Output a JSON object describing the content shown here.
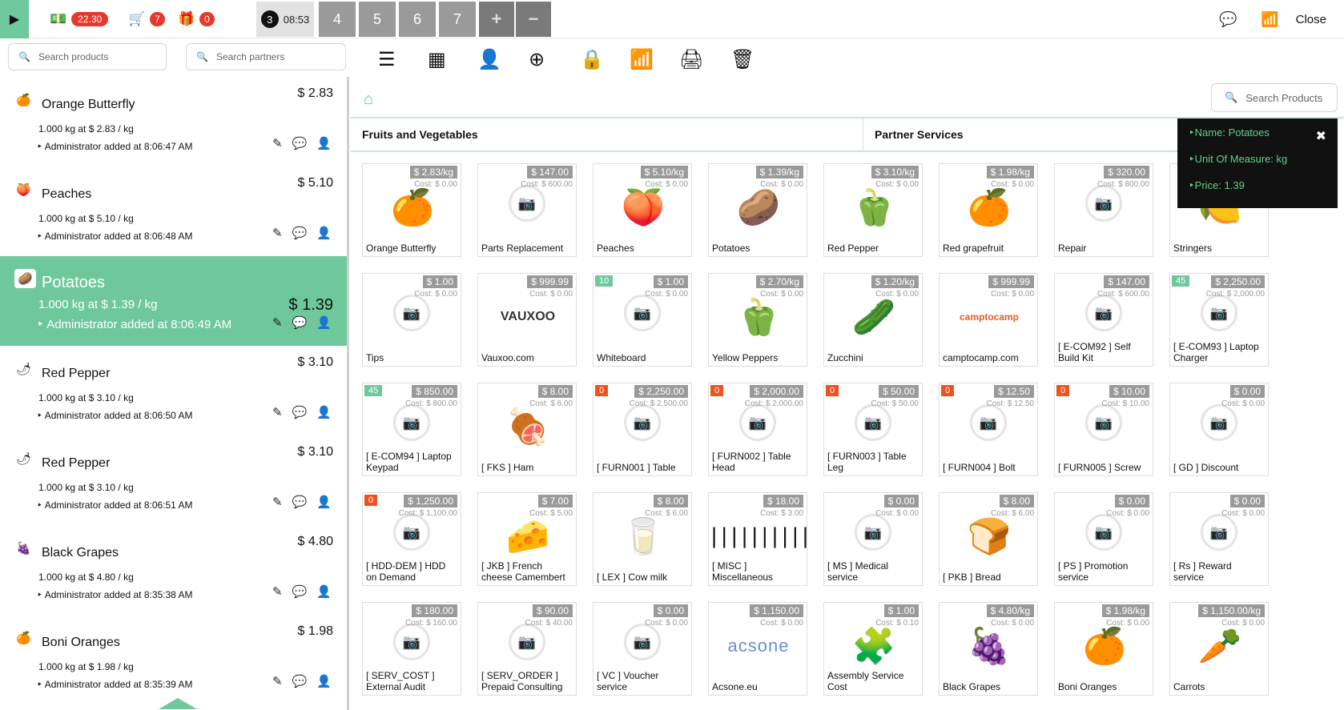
{
  "topbar": {
    "cash_badge": "22.30",
    "cart_count": "7",
    "gift_count": "0",
    "active_order_number": "3",
    "active_order_time": "08:53",
    "order_tabs": [
      "4",
      "5",
      "6",
      "7"
    ],
    "add_order": "+",
    "remove_order": "−",
    "close_label": "Close"
  },
  "left": {
    "search_products_placeholder": "Search products",
    "search_partners_placeholder": "Search partners",
    "lines": [
      {
        "name": "Orange Butterfly",
        "price": "$ 2.83",
        "qty": "1.000 kg at $ 2.83 / kg",
        "note": "Administrator added at 8:06:47 AM",
        "icon": "🍊",
        "selected": false
      },
      {
        "name": "Peaches",
        "price": "$ 5.10",
        "qty": "1.000 kg at $ 5.10 / kg",
        "note": "Administrator added at 8:06:48 AM",
        "icon": "🍑",
        "selected": false
      },
      {
        "name": "Potatoes",
        "price": "$ 1.39",
        "qty": "1.000 kg at $ 1.39 / kg",
        "note": "Administrator added at 8:06:49 AM",
        "icon": "🥔",
        "selected": true
      },
      {
        "name": "Red Pepper",
        "price": "$ 3.10",
        "qty": "1.000 kg at $ 3.10 / kg",
        "note": "Administrator added at 8:06:50 AM",
        "icon": "🌶",
        "selected": false
      },
      {
        "name": "Red Pepper",
        "price": "$ 3.10",
        "qty": "1.000 kg at $ 3.10 / kg",
        "note": "Administrator added at 8:06:51 AM",
        "icon": "🌶",
        "selected": false
      },
      {
        "name": "Black Grapes",
        "price": "$ 4.80",
        "qty": "1.000 kg at $ 4.80 / kg",
        "note": "Administrator added at 8:35:38 AM",
        "icon": "🍇",
        "selected": false
      },
      {
        "name": "Boni Oranges",
        "price": "$ 1.98",
        "qty": "1.000 kg at $ 1.98 / kg",
        "note": "Administrator added at 8:35:39 AM",
        "icon": "🍊",
        "selected": false
      }
    ]
  },
  "main": {
    "categories": [
      "Fruits and Vegetables",
      "Partner Services"
    ],
    "search_placeholder": "Search Products",
    "tooltip": {
      "name": "‣Name: Potatoes",
      "uom": "‣Unit Of Measure: kg",
      "price": "‣Price: 1.39"
    },
    "products": [
      {
        "name": "Orange Butterfly",
        "price": "$ 2.83/kg",
        "cost": "Cost: $ 0.00",
        "stock": "",
        "pic": "🍊"
      },
      {
        "name": "Parts Replacement",
        "price": "$ 147.00",
        "cost": "Cost: $ 600.00",
        "stock": "",
        "pic": ""
      },
      {
        "name": "Peaches",
        "price": "$ 5.10/kg",
        "cost": "Cost: $ 0.00",
        "stock": "",
        "pic": "🍑"
      },
      {
        "name": "Potatoes",
        "price": "$ 1.39/kg",
        "cost": "Cost: $ 0.00",
        "stock": "",
        "pic": "🥔"
      },
      {
        "name": "Red Pepper",
        "price": "$ 3.10/kg",
        "cost": "Cost: $ 0.00",
        "stock": "",
        "pic": "🫑"
      },
      {
        "name": "Red grapefruit",
        "price": "$ 1.98/kg",
        "cost": "Cost: $ 0.00",
        "stock": "",
        "pic": "🍊"
      },
      {
        "name": "Repair",
        "price": "$ 320.00",
        "cost": "Cost: $ 800.00",
        "stock": "",
        "pic": ""
      },
      {
        "name": "Stringers",
        "price": "",
        "cost": "",
        "stock": "",
        "pic": "🍋"
      },
      {
        "name": "Tips",
        "price": "$ 1.00",
        "cost": "Cost: $ 0.00",
        "stock": "",
        "pic": ""
      },
      {
        "name": "Vauxoo.com",
        "price": "$ 999.99",
        "cost": "Cost: $ 0.00",
        "stock": "",
        "pic": "VAUXOO"
      },
      {
        "name": "Whiteboard",
        "price": "$ 1.00",
        "cost": "Cost: $ 0.00",
        "stock": "10",
        "pic": ""
      },
      {
        "name": "Yellow Peppers",
        "price": "$ 2.70/kg",
        "cost": "Cost: $ 0.00",
        "stock": "",
        "pic": "🫑"
      },
      {
        "name": "Zucchini",
        "price": "$ 1.20/kg",
        "cost": "Cost: $ 0.00",
        "stock": "",
        "pic": "🥒"
      },
      {
        "name": "camptocamp.com",
        "price": "$ 999.99",
        "cost": "Cost: $ 0.00",
        "stock": "",
        "pic": "camptocamp"
      },
      {
        "name": "[ E-COM92 ] Self Build Kit",
        "price": "$ 147.00",
        "cost": "Cost: $ 600.00",
        "stock": "",
        "pic": ""
      },
      {
        "name": "[ E-COM93 ] Laptop Charger",
        "price": "$ 2,250.00",
        "cost": "Cost: $ 2,000.00",
        "stock": "45",
        "pic": ""
      },
      {
        "name": "[ E-COM94 ] Laptop Keypad",
        "price": "$ 850.00",
        "cost": "Cost: $ 800.00",
        "stock": "45",
        "pic": ""
      },
      {
        "name": "[ FKS ] Ham",
        "price": "$ 8.00",
        "cost": "Cost: $ 6.00",
        "stock": "",
        "pic": "🍖"
      },
      {
        "name": "[ FURN001 ] Table",
        "price": "$ 2,250.00",
        "cost": "Cost: $ 2,500.00",
        "stock": "0",
        "pic": ""
      },
      {
        "name": "[ FURN002 ] Table Head",
        "price": "$ 2,000.00",
        "cost": "Cost: $ 2,000.00",
        "stock": "0",
        "pic": ""
      },
      {
        "name": "[ FURN003 ] Table Leg",
        "price": "$ 50.00",
        "cost": "Cost: $ 50.00",
        "stock": "0",
        "pic": ""
      },
      {
        "name": "[ FURN004 ] Bolt",
        "price": "$ 12.50",
        "cost": "Cost: $ 12.50",
        "stock": "0",
        "pic": ""
      },
      {
        "name": "[ FURN005 ] Screw",
        "price": "$ 10.00",
        "cost": "Cost: $ 10.00",
        "stock": "0",
        "pic": ""
      },
      {
        "name": "[ GD ] Discount",
        "price": "$ 0.00",
        "cost": "Cost: $ 0.00",
        "stock": "",
        "pic": ""
      },
      {
        "name": "[ HDD-DEM ] HDD on Demand",
        "price": "$ 1,250.00",
        "cost": "Cost: $ 1,100.00",
        "stock": "0",
        "pic": ""
      },
      {
        "name": "[ JKB ] French cheese Camembert",
        "price": "$ 7.00",
        "cost": "Cost: $ 5.00",
        "stock": "",
        "pic": "🧀"
      },
      {
        "name": "[ LEX ] Cow milk",
        "price": "$ 8.00",
        "cost": "Cost: $ 6.00",
        "stock": "",
        "pic": "🥛"
      },
      {
        "name": "[ MISC ] Miscellaneous",
        "price": "$ 18.00",
        "cost": "Cost: $ 3.00",
        "stock": "",
        "pic": "barcode"
      },
      {
        "name": "[ MS ] Medical service",
        "price": "$ 0.00",
        "cost": "Cost: $ 0.00",
        "stock": "",
        "pic": ""
      },
      {
        "name": "[ PKB ] Bread",
        "price": "$ 8.00",
        "cost": "Cost: $ 6.00",
        "stock": "",
        "pic": "🍞"
      },
      {
        "name": "[ PS ] Promotion service",
        "price": "$ 0.00",
        "cost": "Cost: $ 0.00",
        "stock": "",
        "pic": ""
      },
      {
        "name": "[ Rs ] Reward service",
        "price": "$ 0.00",
        "cost": "Cost: $ 0.00",
        "stock": "",
        "pic": ""
      },
      {
        "name": "[ SERV_COST ] External Audit",
        "price": "$ 180.00",
        "cost": "Cost: $ 160.00",
        "stock": "",
        "pic": ""
      },
      {
        "name": "[ SERV_ORDER ] Prepaid Consulting",
        "price": "$ 90.00",
        "cost": "Cost: $ 40.00",
        "stock": "",
        "pic": ""
      },
      {
        "name": "[ VC ] Voucher service",
        "price": "$ 0.00",
        "cost": "Cost: $ 0.00",
        "stock": "",
        "pic": ""
      },
      {
        "name": "Acsone.eu",
        "price": "$ 1,150.00",
        "cost": "Cost: $ 0.00",
        "stock": "",
        "pic": "acsone"
      },
      {
        "name": "Assembly Service Cost",
        "price": "$ 1.00",
        "cost": "Cost: $ 0.10",
        "stock": "",
        "pic": "🧩"
      },
      {
        "name": "Black Grapes",
        "price": "$ 4.80/kg",
        "cost": "Cost: $ 0.00",
        "stock": "",
        "pic": "🍇"
      },
      {
        "name": "Boni Oranges",
        "price": "$ 1.98/kg",
        "cost": "Cost: $ 0.00",
        "stock": "",
        "pic": "🍊"
      },
      {
        "name": "Carrots",
        "price": "$ 1,150.00/kg",
        "cost": "Cost: $ 0.00",
        "stock": "",
        "pic": "🥕"
      }
    ]
  },
  "colors": {
    "accent": "#6ec89b",
    "badge": "#e8382b",
    "stock_zero": "#f0521f"
  }
}
